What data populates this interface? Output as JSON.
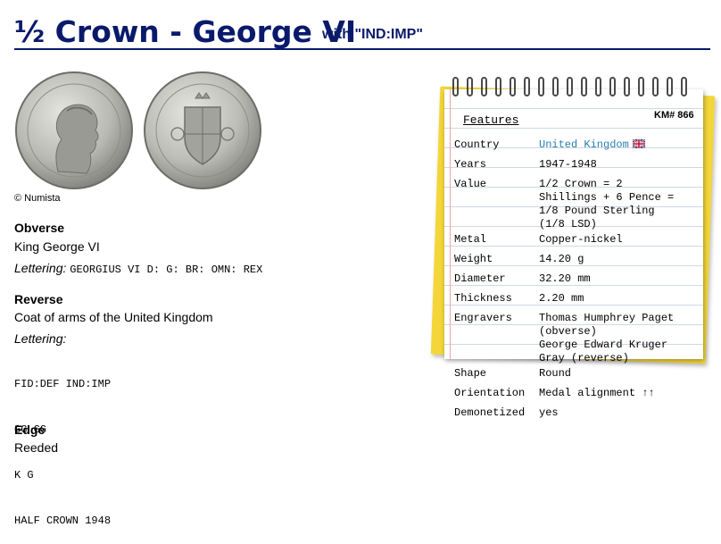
{
  "page": {
    "title_main": "½ Crown - George VI",
    "title_sub": "with \"IND:IMP\""
  },
  "images": {
    "credit": "© Numista"
  },
  "obverse": {
    "heading": "Obverse",
    "description": "King George VI",
    "lettering_label": "Lettering:",
    "lettering": "GEORGIUS VI D: G: BR: OMN: REX"
  },
  "reverse": {
    "heading": "Reverse",
    "description": "Coat of arms of the United Kingdom",
    "lettering_label": "Lettering:",
    "lettering_lines": [
      "FID:DEF IND:IMP",
      "GG GG",
      "K G",
      "HALF CROWN 1948"
    ]
  },
  "edge": {
    "heading": "Edge",
    "description": "Reeded"
  },
  "features": {
    "title": "Features",
    "km": "KM# 866",
    "rows": [
      {
        "key": "Country",
        "value": "United Kingdom"
      },
      {
        "key": "Years",
        "value": "1947-1948"
      },
      {
        "key": "Value",
        "value": "1/2 Crown = 2\nShillings + 6 Pence =\n1/8 Pound Sterling\n(1/8 LSD)"
      },
      {
        "key": "Metal",
        "value": "Copper-nickel"
      },
      {
        "key": "Weight",
        "value": "14.20 g"
      },
      {
        "key": "Diameter",
        "value": "32.20 mm"
      },
      {
        "key": "Thickness",
        "value": "2.20 mm"
      },
      {
        "key": "Engravers",
        "value": "Thomas Humphrey Paget\n(obverse)\nGeorge Edward Kruger\nGray (reverse)"
      },
      {
        "key": "Shape",
        "value": "Round"
      },
      {
        "key": "Orientation",
        "value": "Medal alignment ↑↑"
      },
      {
        "key": "Demonetized",
        "value": "yes"
      }
    ]
  },
  "colors": {
    "title": "#0a1a6b",
    "link": "#2a7fb0",
    "pad_back": "#f4d63a"
  },
  "icons": [
    "uk-flag-icon"
  ]
}
